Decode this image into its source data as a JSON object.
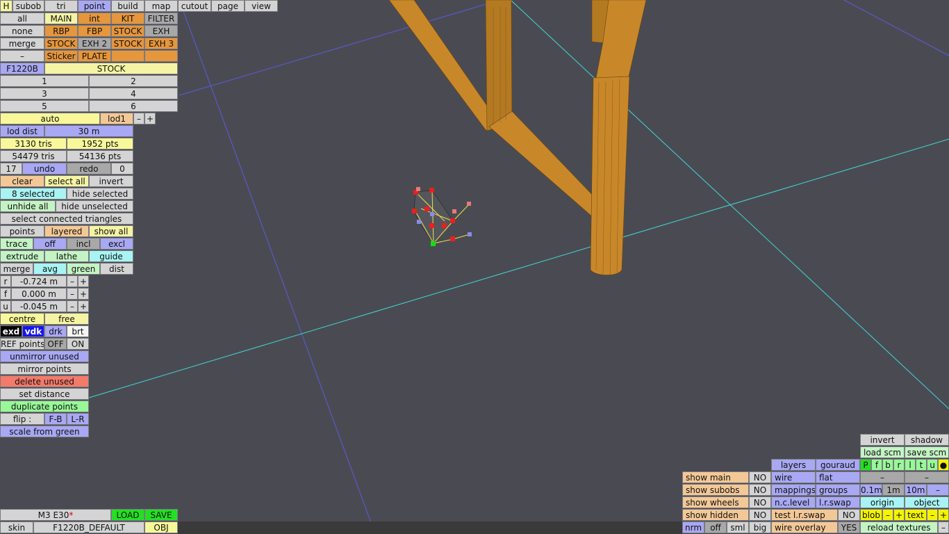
{
  "tabs": {
    "h": "H",
    "subob": "subob",
    "tri": "tri",
    "point": "point",
    "build": "build",
    "map": "map",
    "cutout": "cutout",
    "page": "page",
    "view": "view"
  },
  "subobs": {
    "all": "all",
    "main": "MAIN",
    "int": "int",
    "kit": "KIT",
    "filter": "FILTER",
    "none": "none",
    "rbp": "RBP",
    "fbp": "FBP",
    "stock1": "STOCK",
    "exh": "EXH",
    "merge": "merge",
    "stock2": "STOCK",
    "exh2": "EXH 2",
    "stock3": "STOCK",
    "exh3": "EXH 3",
    "dash": "–",
    "sticker": "Sticker",
    "plate": "PLATE"
  },
  "model": {
    "code": "F1220B",
    "variant": "STOCK"
  },
  "slots": [
    "1",
    "2",
    "3",
    "4",
    "5",
    "6"
  ],
  "lod": {
    "auto": "auto",
    "level": "lod1",
    "minus": "–",
    "plus": "+",
    "dist_label": "lod dist",
    "dist_value": "30 m"
  },
  "stats": {
    "tris1": "3130 tris",
    "pts1": "1952 pts",
    "tris2": "54479 tris",
    "pts2": "54136 pts"
  },
  "history": {
    "count": "17",
    "undo": "undo",
    "redo": "redo",
    "redo_count": "0"
  },
  "selection": {
    "clear": "clear",
    "select_all": "select all",
    "invert": "invert",
    "selected": "8 selected",
    "hide_selected": "hide selected",
    "unhide_all": "unhide all",
    "hide_unselected": "hide unselected",
    "select_connected": "select connected triangles",
    "points": "points",
    "layered": "layered",
    "show_all": "show all"
  },
  "trace": {
    "label": "trace",
    "off": "off",
    "incl": "incl",
    "excl": "excl"
  },
  "tools": {
    "extrude": "extrude",
    "lathe": "lathe",
    "guide": "guide",
    "merge": "merge",
    "avg": "avg",
    "green": "green",
    "dist": "dist"
  },
  "coords": [
    {
      "axis": "r",
      "value": "-0.724 m"
    },
    {
      "axis": "f",
      "value": "0.000 m"
    },
    {
      "axis": "u",
      "value": "-0.045 m"
    }
  ],
  "pivot": {
    "centre": "centre",
    "free": "free"
  },
  "display": {
    "exd": "exd",
    "vdk": "vdk",
    "drk": "drk",
    "brt": "brt"
  },
  "refpoints": {
    "label": "REF points",
    "off": "OFF",
    "on": "ON"
  },
  "actions": {
    "unmirror": "unmirror unused",
    "mirror": "mirror points",
    "delete": "delete unused",
    "set_distance": "set distance",
    "duplicate": "duplicate points",
    "flip": "flip :",
    "fb": "F-B",
    "lr": "L-R",
    "scale": "scale from green"
  },
  "file": {
    "name": "M3 E30",
    "modified": "*",
    "load": "LOAD",
    "save": "SAVE",
    "skin_label": "skin",
    "skin_value": "F1220B_DEFAULT",
    "obj": "OBJ"
  },
  "render": {
    "invert": "invert",
    "shadow": "shadow",
    "load_scm": "load scm",
    "save_scm": "save scm",
    "layers": "layers",
    "gouraud": "gouraud",
    "letters": [
      "P",
      "f",
      "b",
      "r",
      "l",
      "t",
      "u",
      "●"
    ],
    "show_main": "show main",
    "show_subobs": "show subobs",
    "show_wheels": "show wheels",
    "show_hidden": "show hidden",
    "no": "NO",
    "yes": "YES",
    "wire": "wire",
    "flat": "flat",
    "dash": "–",
    "mappings": "mappings",
    "groups": "groups",
    "scales": [
      "0.1m",
      "1m",
      "10m",
      "–"
    ],
    "nc_level": "n.c.level",
    "lr_swap": "l.r.swap",
    "origin": "origin",
    "object": "object",
    "test_lr_swap": "test l.r.swap",
    "blob": "blob",
    "text": "text",
    "minus": "–",
    "plus": "+",
    "nrm": "nrm",
    "off": "off",
    "sml": "sml",
    "big": "big",
    "wire_overlay": "wire overlay",
    "reload_textures": "reload textures"
  }
}
